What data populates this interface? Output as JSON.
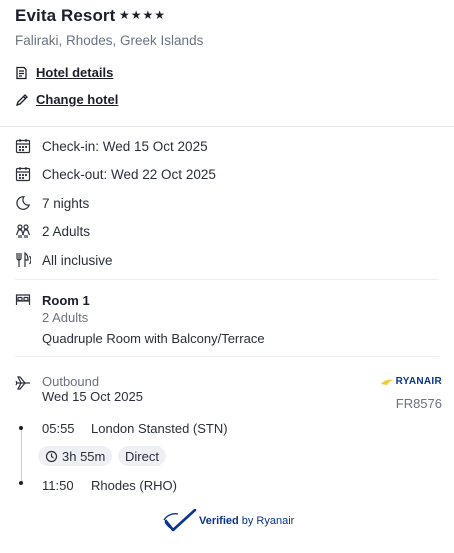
{
  "hotel": {
    "name": "Evita Resort",
    "stars": "★★★★",
    "location": "Faliraki, Rhodes, Greek Islands",
    "details_link": "Hotel details",
    "change_link": "Change hotel"
  },
  "stay": {
    "checkin": "Check-in: Wed 15 Oct 2025",
    "checkout": "Check-out: Wed 22 Oct 2025",
    "nights": "7 nights",
    "guests": "2 Adults",
    "board": "All inclusive"
  },
  "room": {
    "title": "Room 1",
    "occupancy": "2 Adults",
    "type": "Quadruple Room with Balcony/Terrace"
  },
  "flight": {
    "direction": "Outbound",
    "date": "Wed 15 Oct 2025",
    "airline": "RYANAIR",
    "flight_number": "FR8576",
    "departure_time": "05:55",
    "departure_place": "London Stansted (STN)",
    "duration": "3h 55m",
    "stops": "Direct",
    "arrival_time": "11:50",
    "arrival_place": "Rhodes (RHO)"
  },
  "footer": {
    "verified": "Verified",
    "by": "by Ryanair"
  },
  "icons": {
    "calendar": "calendar-icon",
    "moon": "moon-icon",
    "people": "people-icon",
    "cutlery": "cutlery-icon",
    "bed": "bed-icon",
    "plane": "plane-icon",
    "clock": "clock-icon",
    "document": "document-icon",
    "pencil": "pencil-icon"
  },
  "colors": {
    "brand_blue": "#073590",
    "brand_yellow": "#f1c933"
  }
}
